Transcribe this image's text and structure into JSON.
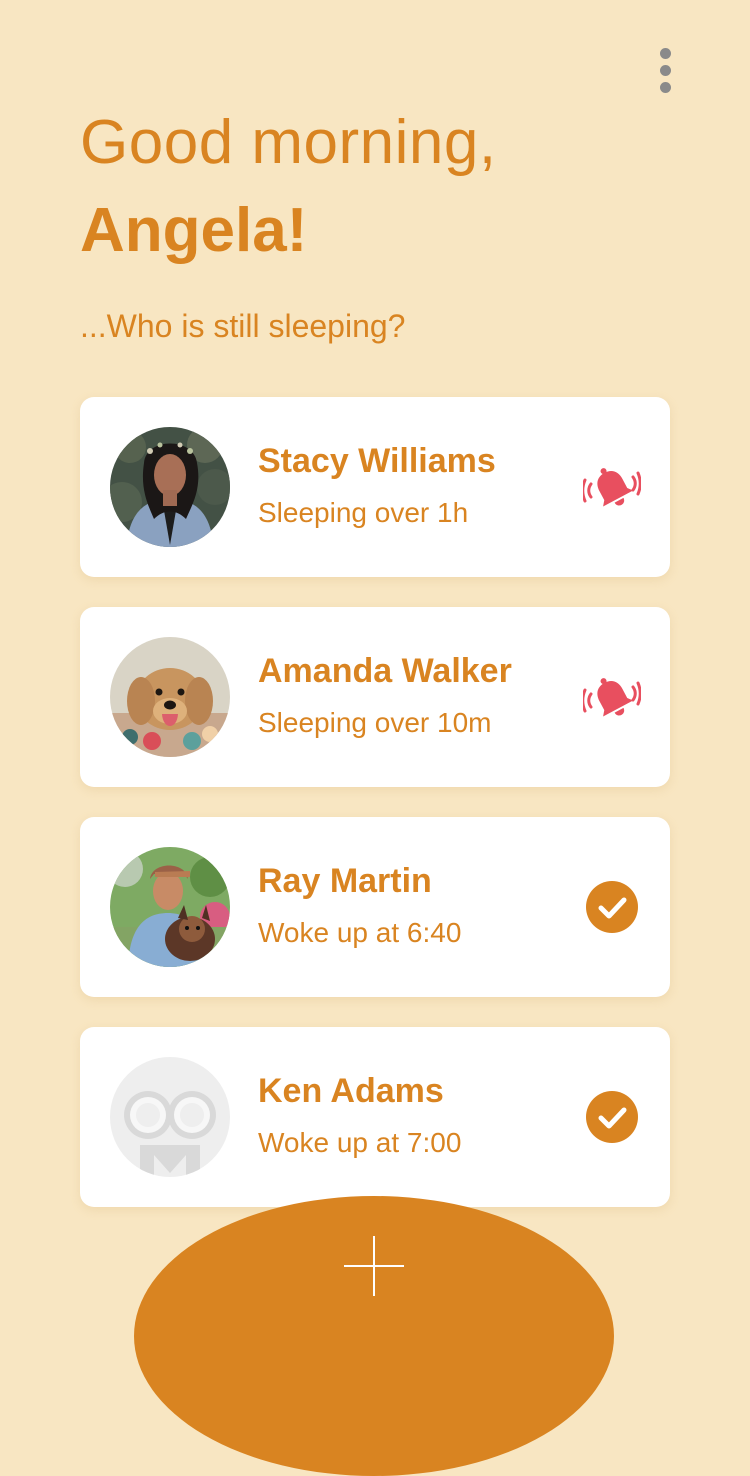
{
  "header": {
    "greeting": "Good morning,",
    "name": "Angela!",
    "subtitle": "...Who is still sleeping?"
  },
  "menu": {
    "icon": "more-vertical-icon"
  },
  "people": [
    {
      "name": "Stacy Williams",
      "status": "Sleeping over 1h",
      "state": "sleeping",
      "avatar": "woman-portrait",
      "icon": "ringing-bell-icon"
    },
    {
      "name": "Amanda Walker",
      "status": "Sleeping over 10m",
      "state": "sleeping",
      "avatar": "dog-portrait",
      "icon": "ringing-bell-icon"
    },
    {
      "name": "Ray Martin",
      "status": "Woke up at 6:40",
      "state": "awake",
      "avatar": "man-with-dog-portrait",
      "icon": "check-circle-icon"
    },
    {
      "name": "Ken Adams",
      "status": "Woke up at 7:00",
      "state": "awake",
      "avatar": "placeholder-avatar",
      "icon": "check-circle-icon"
    }
  ],
  "actions": {
    "add_icon": "plus-icon"
  },
  "colors": {
    "background": "#f8e6c2",
    "accent": "#d98421",
    "alert": "#e84f5f",
    "card": "#ffffff"
  }
}
